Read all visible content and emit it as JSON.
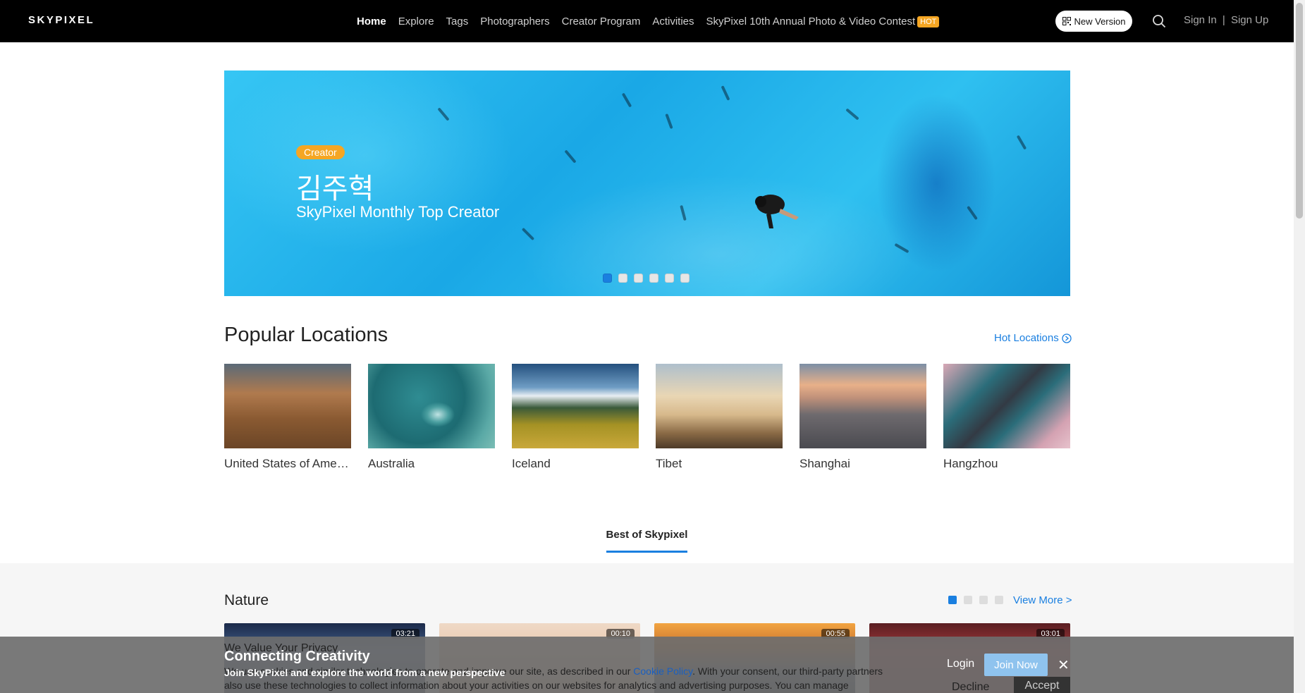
{
  "header": {
    "logo": "SKYPIXEL",
    "nav": [
      {
        "label": "Home",
        "active": true
      },
      {
        "label": "Explore"
      },
      {
        "label": "Tags"
      },
      {
        "label": "Photographers"
      },
      {
        "label": "Creator Program"
      },
      {
        "label": "Activities"
      },
      {
        "label": "SkyPixel 10th Annual Photo & Video Contest"
      }
    ],
    "hot_badge": "HOT",
    "new_version": "New Version",
    "sign_in": "Sign In",
    "separator": "|",
    "sign_up": "Sign Up"
  },
  "hero": {
    "badge": "Creator",
    "name": "김주혁",
    "subtitle": "SkyPixel Monthly Top Creator",
    "slide_count": 6,
    "active_slide": 1
  },
  "popular": {
    "title": "Popular Locations",
    "hot_link": "Hot Locations",
    "locations": [
      {
        "label": "United States of America"
      },
      {
        "label": "Australia"
      },
      {
        "label": "Iceland"
      },
      {
        "label": "Tibet"
      },
      {
        "label": "Shanghai"
      },
      {
        "label": "Hangzhou"
      }
    ]
  },
  "tabs": {
    "best": "Best of Skypixel"
  },
  "nature": {
    "title": "Nature",
    "view_more": "View More >",
    "page_count": 4,
    "active_page": 1,
    "videos": [
      {
        "duration": "03:21"
      },
      {
        "duration": "00:10"
      },
      {
        "duration": "00:55"
      },
      {
        "duration": "03:01"
      }
    ]
  },
  "privacy": {
    "title": "We Value Your Privacy",
    "text_before": "We use cookies and similar technologies to operate and improve our site, as described in our ",
    "cookie_link": "Cookie Policy",
    "text_after": ". With your consent, our third-party partners also use these technologies to collect information about your activities on our websites for analytics and advertising purposes. You can manage",
    "decline": "Decline",
    "accept": "Accept"
  },
  "join_banner": {
    "title": "Connecting Creativity",
    "subtitle": "Join SkyPixel and explore the world from a new perspective",
    "login": "Login",
    "join": "Join Now",
    "close": "✕"
  },
  "colors": {
    "accent": "#1a7fe0",
    "badge": "#f5a623",
    "header_bg": "#000000"
  }
}
